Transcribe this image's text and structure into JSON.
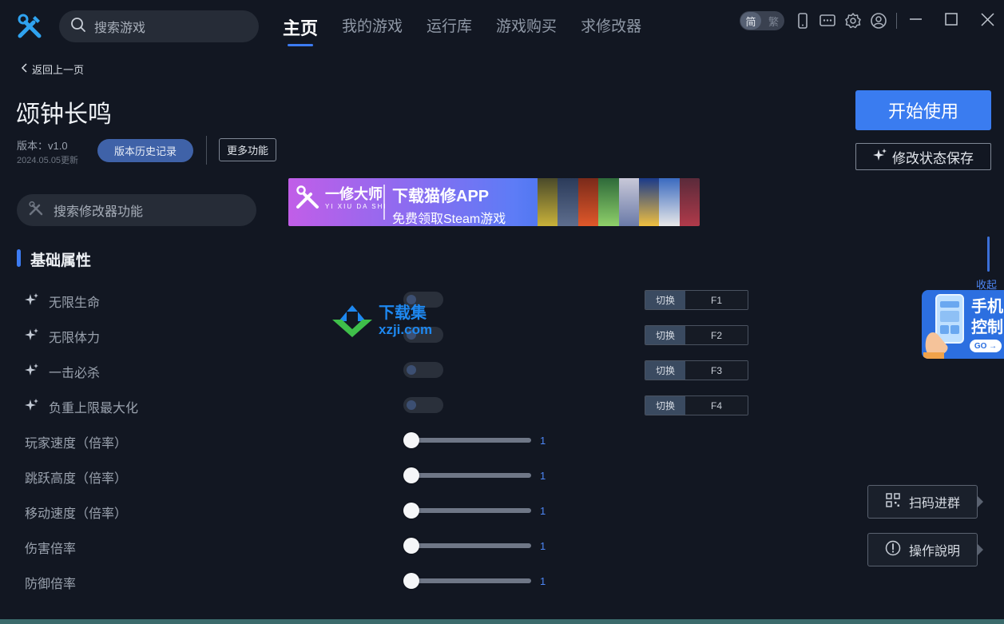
{
  "header": {
    "search_placeholder": "搜索游戏",
    "tabs": [
      {
        "label": "主页",
        "active": true
      },
      {
        "label": "我的游戏",
        "active": false
      },
      {
        "label": "运行库",
        "active": false
      },
      {
        "label": "游戏购买",
        "active": false
      },
      {
        "label": "求修改器",
        "active": false
      }
    ],
    "lang": {
      "simplified": "简",
      "traditional": "繁"
    }
  },
  "back_label": "返回上一页",
  "game": {
    "title": "颂钟长鸣",
    "version": "版本：v1.0",
    "updated": "2024.05.05更新",
    "history_button": "版本历史记录",
    "more_button": "更多功能"
  },
  "modifier_search_placeholder": "搜索修改器功能",
  "banner": {
    "brand": "一修大师",
    "brand_pinyin": "YI XIU DA SHI",
    "line1": "下载猫修APP",
    "line2": "免费领取Steam游戏"
  },
  "section_title": "基础属性",
  "toggles": [
    {
      "label": "无限生命",
      "switch": "切换",
      "key": "F1",
      "on": false
    },
    {
      "label": "无限体力",
      "switch": "切换",
      "key": "F2",
      "on": false
    },
    {
      "label": "一击必杀",
      "switch": "切换",
      "key": "F3",
      "on": false
    },
    {
      "label": "负重上限最大化",
      "switch": "切换",
      "key": "F4",
      "on": false
    }
  ],
  "sliders": [
    {
      "label": "玩家速度（倍率）",
      "value": "1"
    },
    {
      "label": "跳跃高度（倍率）",
      "value": "1"
    },
    {
      "label": "移动速度（倍率）",
      "value": "1"
    },
    {
      "label": "伤害倍率",
      "value": "1"
    },
    {
      "label": "防御倍率",
      "value": "1"
    }
  ],
  "right_panel": {
    "start_button": "开始使用",
    "save_button": "修改状态保存",
    "collapse": "收起",
    "phone_card_text": "手机控制",
    "phone_card_go": "GO →",
    "qr_button": "扫码进群",
    "help_button": "操作說明"
  },
  "watermark": {
    "line1": "下载集",
    "line2": "xzji.com"
  },
  "colors": {
    "accent": "#3c7bf2",
    "background": "#121722"
  }
}
